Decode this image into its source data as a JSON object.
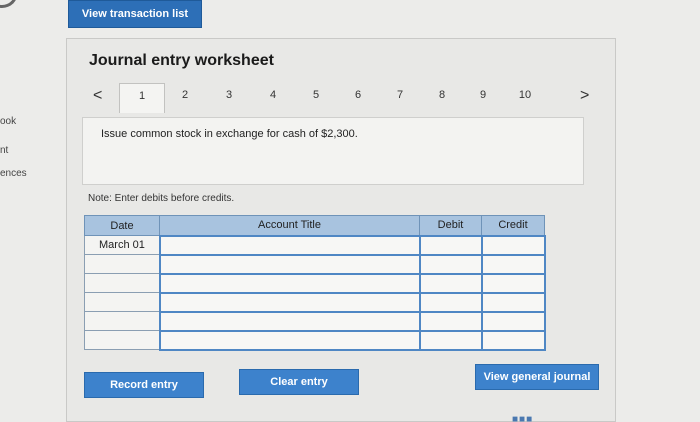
{
  "sidebar": {
    "labels": [
      "ook",
      "nt",
      "ences"
    ]
  },
  "header": {
    "view_transaction_list": "View transaction list"
  },
  "worksheet": {
    "title": "Journal entry worksheet",
    "prev_icon": "<",
    "next_icon": ">",
    "tabs": [
      "1",
      "2",
      "3",
      "4",
      "5",
      "6",
      "7",
      "8",
      "9",
      "10"
    ],
    "active_tab": "1",
    "task": "Issue common stock in exchange for cash of $2,300.",
    "note": "Note: Enter debits before credits.",
    "table": {
      "headers": {
        "date": "Date",
        "account_title": "Account Title",
        "debit": "Debit",
        "credit": "Credit"
      },
      "first_date": "March 01"
    }
  },
  "buttons": {
    "record_entry": "Record entry",
    "clear_entry": "Clear entry",
    "view_general_journal": "View general journal"
  },
  "colors": {
    "primary_button": "#3d82cc",
    "table_header": "#a8c3df",
    "field_border": "#4f87c4"
  }
}
